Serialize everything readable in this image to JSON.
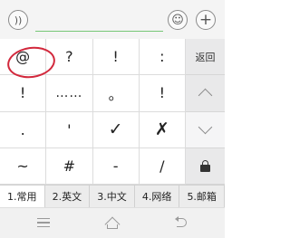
{
  "topbar": {
    "voice_icon": "voice-input-icon",
    "emoji_icon": "emoji-icon",
    "plus_icon": "plus-icon",
    "emoji_glyph": "☺",
    "plus_glyph": "+",
    "voice_glyph": "))"
  },
  "keys": {
    "r1": [
      "@",
      "?",
      "!",
      ":"
    ],
    "r2": [
      "!",
      "……",
      "。",
      "!"
    ],
    "r3": [
      ".",
      "'",
      "✓",
      "✗"
    ],
    "r4": [
      "~",
      "#",
      "-",
      "/"
    ]
  },
  "side": {
    "back_label": "返回",
    "up_icon": "chevron-up-icon",
    "down_icon": "chevron-down-icon",
    "lock_icon": "lock-icon"
  },
  "tabs": [
    "1.常用",
    "2.英文",
    "3.中文",
    "4.网络",
    "5.邮箱"
  ],
  "active_tab": 0,
  "annotation_color": "#d2283c",
  "navbar": {
    "menu_icon": "menu-icon",
    "home_icon": "home-icon",
    "back_icon": "back-icon"
  }
}
